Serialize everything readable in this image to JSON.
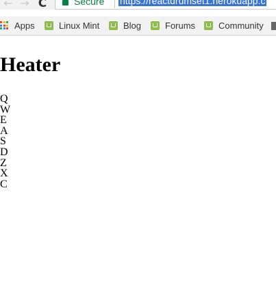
{
  "browser": {
    "back_icon": "arrow-left-icon",
    "forward_icon": "arrow-right-icon",
    "reload_icon": "reload-icon",
    "back_glyph": "←",
    "forward_glyph": "→",
    "reload_glyph": "C",
    "secure_label": "Secure",
    "url": "https://reactdrumset1.herokuapp.c"
  },
  "bookmarks": [
    {
      "label": "Apps",
      "icon": "apps-grid-icon"
    },
    {
      "label": "Linux Mint",
      "icon": "linux-mint-icon"
    },
    {
      "label": "Blog",
      "icon": "linux-mint-icon"
    },
    {
      "label": "Forums",
      "icon": "linux-mint-icon"
    },
    {
      "label": "Community",
      "icon": "linux-mint-icon"
    }
  ],
  "page": {
    "title": "Heater",
    "pads": [
      "Q",
      "W",
      "E",
      "A",
      "S",
      "D",
      "Z",
      "X",
      "C"
    ]
  },
  "colors": {
    "secure_green": "#0b8043",
    "url_highlight": "#3875d7",
    "mint_green": "#8fbd4b"
  }
}
